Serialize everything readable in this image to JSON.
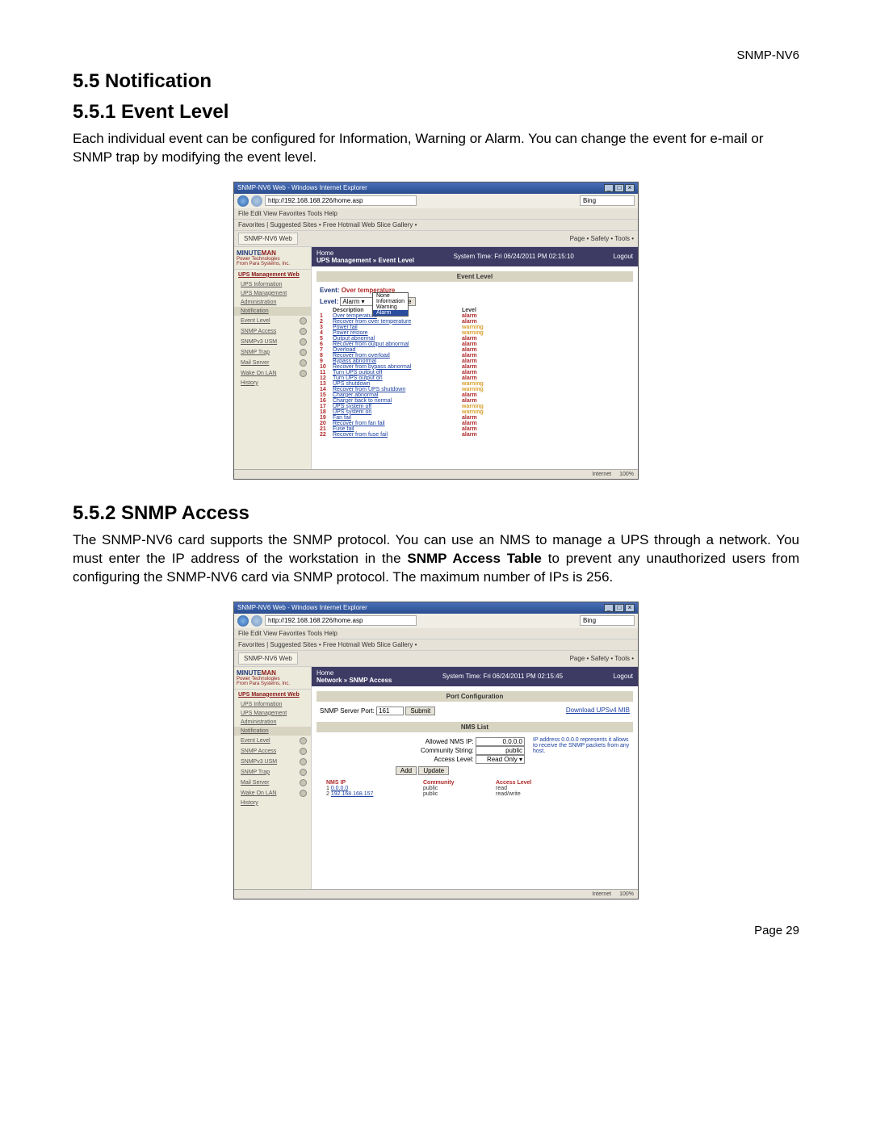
{
  "doc": {
    "product": "SNMP-NV6",
    "page_number": "Page 29",
    "h_notification": "5.5 Notification",
    "h_event_level": "5.5.1 Event Level",
    "p_event_level": "Each individual event can be configured for Information, Warning or Alarm. You can change the event for e-mail or SNMP trap by modifying the event level.",
    "h_snmp_access": "5.5.2 SNMP Access",
    "p_snmp_access_1": "The SNMP-NV6 card supports the SNMP protocol. You can use an NMS to manage a UPS through a network. You must enter the IP address of the workstation in the ",
    "p_snmp_access_bold": "SNMP Access Table",
    "p_snmp_access_2": " to prevent any unauthorized users from configuring the SNMP-NV6 card via SNMP protocol. The maximum number of IPs is 256."
  },
  "shot_common": {
    "ie_title": "SNMP-NV6 Web - Windows Internet Explorer",
    "url": "http://192.168.168.226/home.asp",
    "search_engine": "Bing",
    "menus": "File   Edit   View   Favorites   Tools   Help",
    "fav_bar": "Favorites   |  Suggested Sites •   Free Hotmail   Web Slice Gallery •",
    "tab_label": "SNMP-NV6 Web",
    "toolbar": "Page •  Safety •  Tools •",
    "brand_line1": "MINUTE",
    "brand_line1b": "MAN",
    "brand_line2": "Power Technologies",
    "brand_line3": "From Para Systems, Inc.",
    "home_link": "Home",
    "logout": "Logout",
    "status_internet": "Internet",
    "status_zoom": "100%"
  },
  "sidebar": {
    "heading": "UPS Management Web",
    "items": [
      {
        "label": "UPS Information",
        "dot": false
      },
      {
        "label": "UPS Management",
        "dot": false
      },
      {
        "label": "Administration",
        "dot": false
      },
      {
        "label": "Notification",
        "dot": false
      },
      {
        "label": "Event Level",
        "dot": true
      },
      {
        "label": "SNMP Access",
        "dot": true
      },
      {
        "label": "SNMPv3 USM",
        "dot": true
      },
      {
        "label": "SNMP Trap",
        "dot": true
      },
      {
        "label": "Mail Server",
        "dot": true
      },
      {
        "label": "Wake On LAN",
        "dot": true
      },
      {
        "label": "History",
        "dot": false
      }
    ]
  },
  "shot1": {
    "system_time": "System Time: Fri 06/24/2011 PM 02:15:10",
    "crumb": "UPS Management » Event Level",
    "section_title": "Event Level",
    "event_label": "Event:",
    "event_value": "Over temperature",
    "level_label": "Level:",
    "level_selected": "Alarm",
    "update_btn": "Update",
    "dropdown": [
      "None",
      "Information",
      "Warning",
      "Alarm"
    ],
    "col_desc": "Description",
    "col_level": "Level",
    "events": [
      {
        "n": "1",
        "d": "Over temperature",
        "l": "alarm"
      },
      {
        "n": "2",
        "d": "Recover from over temperature",
        "l": "alarm"
      },
      {
        "n": "3",
        "d": "Power fail",
        "l": "warning"
      },
      {
        "n": "4",
        "d": "Power restore",
        "l": "warning"
      },
      {
        "n": "5",
        "d": "Output abnormal",
        "l": "alarm"
      },
      {
        "n": "6",
        "d": "Recover from output abnormal",
        "l": "alarm"
      },
      {
        "n": "7",
        "d": "Overload",
        "l": "alarm"
      },
      {
        "n": "8",
        "d": "Recover from overload",
        "l": "alarm"
      },
      {
        "n": "9",
        "d": "Bypass abnormal",
        "l": "alarm"
      },
      {
        "n": "10",
        "d": "Recover from bypass abnormal",
        "l": "alarm"
      },
      {
        "n": "11",
        "d": "Turn UPS output off",
        "l": "alarm"
      },
      {
        "n": "12",
        "d": "Turn UPS output on",
        "l": "alarm"
      },
      {
        "n": "13",
        "d": "UPS shutdown",
        "l": "warning"
      },
      {
        "n": "14",
        "d": "Recover from UPS shutdown",
        "l": "warning"
      },
      {
        "n": "15",
        "d": "Charger abnormal",
        "l": "alarm"
      },
      {
        "n": "16",
        "d": "Charger back to normal",
        "l": "alarm"
      },
      {
        "n": "17",
        "d": "UPS system off",
        "l": "warning"
      },
      {
        "n": "18",
        "d": "UPS system on",
        "l": "warning"
      },
      {
        "n": "19",
        "d": "Fan fail",
        "l": "alarm"
      },
      {
        "n": "20",
        "d": "Recover from fan fail",
        "l": "alarm"
      },
      {
        "n": "21",
        "d": "Fuse fail",
        "l": "alarm"
      },
      {
        "n": "22",
        "d": "Recover from fuse fail",
        "l": "alarm"
      }
    ]
  },
  "shot2": {
    "system_time": "System Time: Fri 06/24/2011 PM 02:15:45",
    "crumb": "Network » SNMP Access",
    "section_port": "Port Configuration",
    "port_label": "SNMP Server Port:",
    "port_value": "161",
    "submit_btn": "Submit",
    "download_mib": "Download UPSv4 MIB",
    "section_nms": "NMS List",
    "allowed_ip_lbl": "Allowed NMS IP:",
    "allowed_ip_val": "0.0.0.0",
    "community_lbl": "Community String:",
    "community_val": "public",
    "access_lbl": "Access Level:",
    "access_val": "Read Only",
    "add_btn": "Add",
    "update_btn": "Update",
    "hint": "IP address 0.0.0.0 represents it allows to receive the SNMP packets from any host.",
    "col_ip": "NMS IP",
    "col_comm": "Community",
    "col_access": "Access Level",
    "rows": [
      {
        "n": "1",
        "ip": "0.0.0.0",
        "comm": "public",
        "acc": "read"
      },
      {
        "n": "2",
        "ip": "192.168.168.157",
        "comm": "public",
        "acc": "read/write"
      }
    ]
  }
}
